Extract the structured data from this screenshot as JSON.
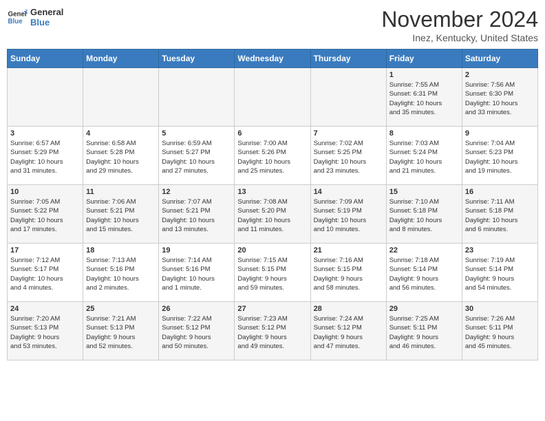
{
  "logo": {
    "line1": "General",
    "line2": "Blue"
  },
  "title": "November 2024",
  "location": "Inez, Kentucky, United States",
  "days_of_week": [
    "Sunday",
    "Monday",
    "Tuesday",
    "Wednesday",
    "Thursday",
    "Friday",
    "Saturday"
  ],
  "weeks": [
    [
      {
        "day": "",
        "info": ""
      },
      {
        "day": "",
        "info": ""
      },
      {
        "day": "",
        "info": ""
      },
      {
        "day": "",
        "info": ""
      },
      {
        "day": "",
        "info": ""
      },
      {
        "day": "1",
        "info": "Sunrise: 7:55 AM\nSunset: 6:31 PM\nDaylight: 10 hours\nand 35 minutes."
      },
      {
        "day": "2",
        "info": "Sunrise: 7:56 AM\nSunset: 6:30 PM\nDaylight: 10 hours\nand 33 minutes."
      }
    ],
    [
      {
        "day": "3",
        "info": "Sunrise: 6:57 AM\nSunset: 5:29 PM\nDaylight: 10 hours\nand 31 minutes."
      },
      {
        "day": "4",
        "info": "Sunrise: 6:58 AM\nSunset: 5:28 PM\nDaylight: 10 hours\nand 29 minutes."
      },
      {
        "day": "5",
        "info": "Sunrise: 6:59 AM\nSunset: 5:27 PM\nDaylight: 10 hours\nand 27 minutes."
      },
      {
        "day": "6",
        "info": "Sunrise: 7:00 AM\nSunset: 5:26 PM\nDaylight: 10 hours\nand 25 minutes."
      },
      {
        "day": "7",
        "info": "Sunrise: 7:02 AM\nSunset: 5:25 PM\nDaylight: 10 hours\nand 23 minutes."
      },
      {
        "day": "8",
        "info": "Sunrise: 7:03 AM\nSunset: 5:24 PM\nDaylight: 10 hours\nand 21 minutes."
      },
      {
        "day": "9",
        "info": "Sunrise: 7:04 AM\nSunset: 5:23 PM\nDaylight: 10 hours\nand 19 minutes."
      }
    ],
    [
      {
        "day": "10",
        "info": "Sunrise: 7:05 AM\nSunset: 5:22 PM\nDaylight: 10 hours\nand 17 minutes."
      },
      {
        "day": "11",
        "info": "Sunrise: 7:06 AM\nSunset: 5:21 PM\nDaylight: 10 hours\nand 15 minutes."
      },
      {
        "day": "12",
        "info": "Sunrise: 7:07 AM\nSunset: 5:21 PM\nDaylight: 10 hours\nand 13 minutes."
      },
      {
        "day": "13",
        "info": "Sunrise: 7:08 AM\nSunset: 5:20 PM\nDaylight: 10 hours\nand 11 minutes."
      },
      {
        "day": "14",
        "info": "Sunrise: 7:09 AM\nSunset: 5:19 PM\nDaylight: 10 hours\nand 10 minutes."
      },
      {
        "day": "15",
        "info": "Sunrise: 7:10 AM\nSunset: 5:18 PM\nDaylight: 10 hours\nand 8 minutes."
      },
      {
        "day": "16",
        "info": "Sunrise: 7:11 AM\nSunset: 5:18 PM\nDaylight: 10 hours\nand 6 minutes."
      }
    ],
    [
      {
        "day": "17",
        "info": "Sunrise: 7:12 AM\nSunset: 5:17 PM\nDaylight: 10 hours\nand 4 minutes."
      },
      {
        "day": "18",
        "info": "Sunrise: 7:13 AM\nSunset: 5:16 PM\nDaylight: 10 hours\nand 2 minutes."
      },
      {
        "day": "19",
        "info": "Sunrise: 7:14 AM\nSunset: 5:16 PM\nDaylight: 10 hours\nand 1 minute."
      },
      {
        "day": "20",
        "info": "Sunrise: 7:15 AM\nSunset: 5:15 PM\nDaylight: 9 hours\nand 59 minutes."
      },
      {
        "day": "21",
        "info": "Sunrise: 7:16 AM\nSunset: 5:15 PM\nDaylight: 9 hours\nand 58 minutes."
      },
      {
        "day": "22",
        "info": "Sunrise: 7:18 AM\nSunset: 5:14 PM\nDaylight: 9 hours\nand 56 minutes."
      },
      {
        "day": "23",
        "info": "Sunrise: 7:19 AM\nSunset: 5:14 PM\nDaylight: 9 hours\nand 54 minutes."
      }
    ],
    [
      {
        "day": "24",
        "info": "Sunrise: 7:20 AM\nSunset: 5:13 PM\nDaylight: 9 hours\nand 53 minutes."
      },
      {
        "day": "25",
        "info": "Sunrise: 7:21 AM\nSunset: 5:13 PM\nDaylight: 9 hours\nand 52 minutes."
      },
      {
        "day": "26",
        "info": "Sunrise: 7:22 AM\nSunset: 5:12 PM\nDaylight: 9 hours\nand 50 minutes."
      },
      {
        "day": "27",
        "info": "Sunrise: 7:23 AM\nSunset: 5:12 PM\nDaylight: 9 hours\nand 49 minutes."
      },
      {
        "day": "28",
        "info": "Sunrise: 7:24 AM\nSunset: 5:12 PM\nDaylight: 9 hours\nand 47 minutes."
      },
      {
        "day": "29",
        "info": "Sunrise: 7:25 AM\nSunset: 5:11 PM\nDaylight: 9 hours\nand 46 minutes."
      },
      {
        "day": "30",
        "info": "Sunrise: 7:26 AM\nSunset: 5:11 PM\nDaylight: 9 hours\nand 45 minutes."
      }
    ]
  ]
}
